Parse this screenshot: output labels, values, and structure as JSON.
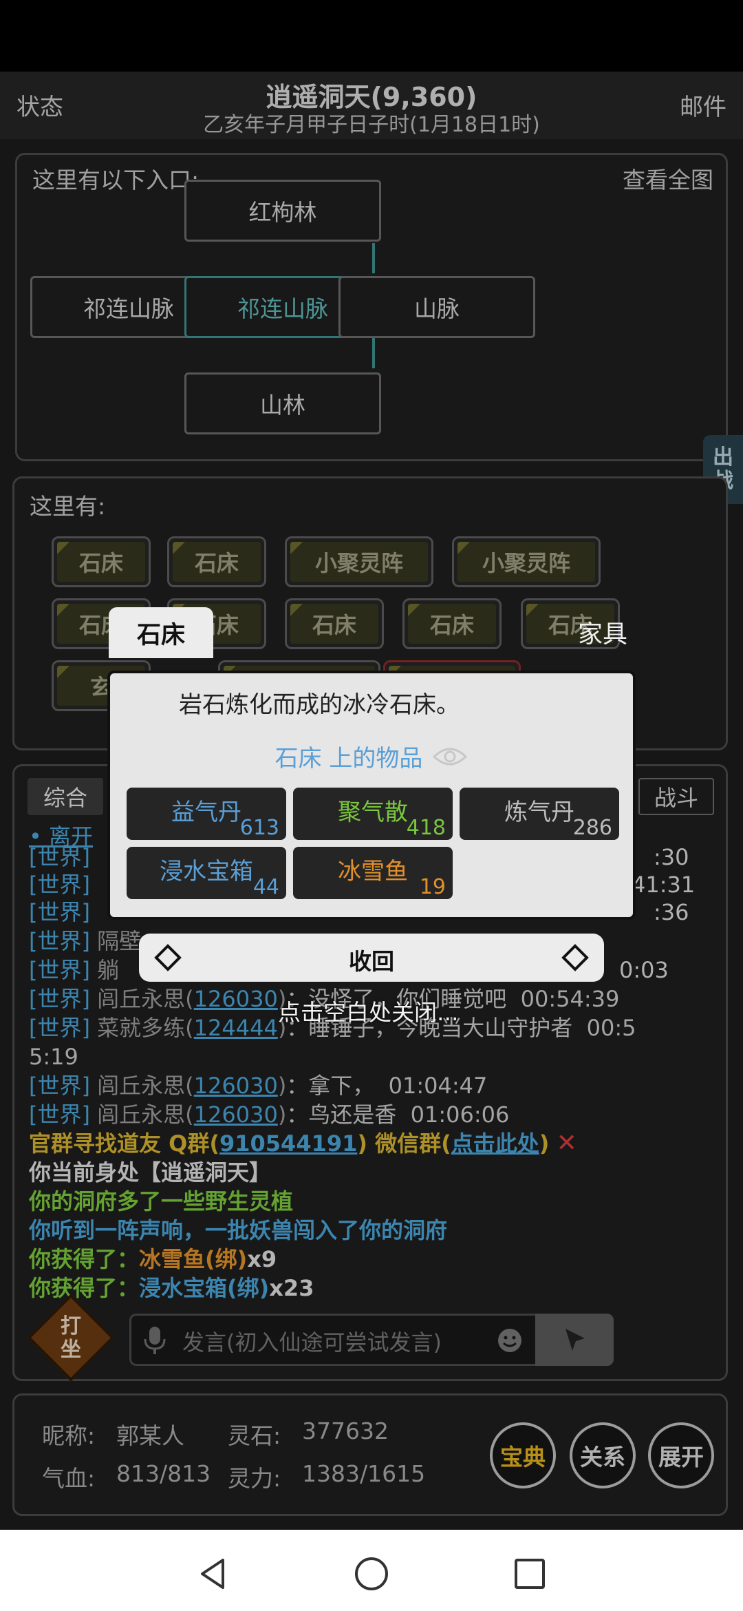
{
  "header": {
    "left": "状态",
    "title": "逍遥洞天(9,360)",
    "time": "乙亥年子月甲子日子时(1月18日1时)",
    "right": "邮件"
  },
  "map": {
    "label": "这里有以下入口:",
    "view_all": "查看全图",
    "nodes": {
      "north": "红枸林",
      "west": "祁连山脉",
      "center": "祁连山脉",
      "east": "山脉",
      "south": "山林"
    }
  },
  "side_tab": [
    "出",
    "战"
  ],
  "objects": {
    "label": "这里有:",
    "row1": [
      "石床",
      "石床",
      "小聚灵阵",
      "小聚灵阵"
    ],
    "row2": [
      "石床",
      "石床",
      "石床",
      "石床",
      "石床"
    ],
    "row3": [
      "玄"
    ]
  },
  "chat": {
    "tabs": {
      "all": "综合",
      "fight": "战斗"
    },
    "leave": "• 离开",
    "lines": {
      "l1": {
        "ch": "[世界]",
        "tm": ":30"
      },
      "l2": {
        "ch": "[世界]",
        "tm": "41:31"
      },
      "l3": {
        "ch": "[世界]",
        "tm": ":36"
      },
      "l4": {
        "ch": "[世界]",
        "nm": "隔壁"
      },
      "l5": {
        "ch": "[世界]",
        "nm": "躺",
        "tm": "0:03"
      },
      "l6": {
        "ch": "[世界]",
        "nm": "闾丘永思",
        "uid": "126030",
        "msg": "：没怪了，你们睡觉吧",
        "tm": "00:54:39"
      },
      "l7": {
        "ch": "[世界]",
        "nm": "菜就多练",
        "uid": "124444",
        "msg": "：睡锤子，今晚当大山守护者",
        "tm": "00:5",
        "tm2": "5:19"
      },
      "l8": {
        "ch": "[世界]",
        "nm": "闾丘永思",
        "uid": "126030",
        "msg": "：拿下，",
        "tm": "01:04:47"
      },
      "l9": {
        "ch": "[世界]",
        "nm": "闾丘永思",
        "uid": "126030",
        "msg": "：鸟还是香",
        "tm": "01:06:06"
      }
    },
    "group": {
      "a": "官群寻找道友 Q群(",
      "qq": "910544191",
      "b": ") 微信群(",
      "link": "点击此处",
      "c": ")",
      "close": "✕"
    },
    "sys1": "你当前身处【逍遥洞天】",
    "sys2": "你的洞府多了一些野生灵植",
    "sys3": "你听到一阵声响，一批妖兽闯入了你的洞府",
    "gain1": {
      "a": "你获得了：",
      "item": "冰雪鱼(绑)",
      "n": "x9"
    },
    "gain2": {
      "a": "你获得了：",
      "item": "浸水宝箱(绑)",
      "n": "x23"
    },
    "meditate": [
      "打",
      "坐"
    ],
    "input_placeholder": "发言(初入仙途可尝试发言)"
  },
  "popup": {
    "title": "石床",
    "category": "家具",
    "desc": "岩石炼化而成的冰冷石床。",
    "items_label": "石床 上的物品",
    "items": [
      {
        "name": "益气丹",
        "count": "613"
      },
      {
        "name": "聚气散",
        "count": "418"
      },
      {
        "name": "炼气丹",
        "count": "286"
      },
      {
        "name": "浸水宝箱",
        "count": "44"
      },
      {
        "name": "冰雪鱼",
        "count": "19"
      }
    ],
    "collapse": "收回",
    "close_hint": "点击空白处关闭..."
  },
  "stats": {
    "nick_label": "昵称:",
    "nick": "郭某人",
    "stone_label": "灵石:",
    "stone": "377632",
    "hp_label": "气血:",
    "hp": "813/813",
    "mp_label": "灵力:",
    "mp": "1383/1615",
    "buttons": {
      "codex": "宝典",
      "relation": "关系",
      "expand": "展开"
    }
  },
  "colors": {
    "accent_teal": "#3e8f8f",
    "world": "#4aa3d6",
    "gold": "#d4b030",
    "green": "#7ac63c",
    "orange": "#e0902a"
  }
}
